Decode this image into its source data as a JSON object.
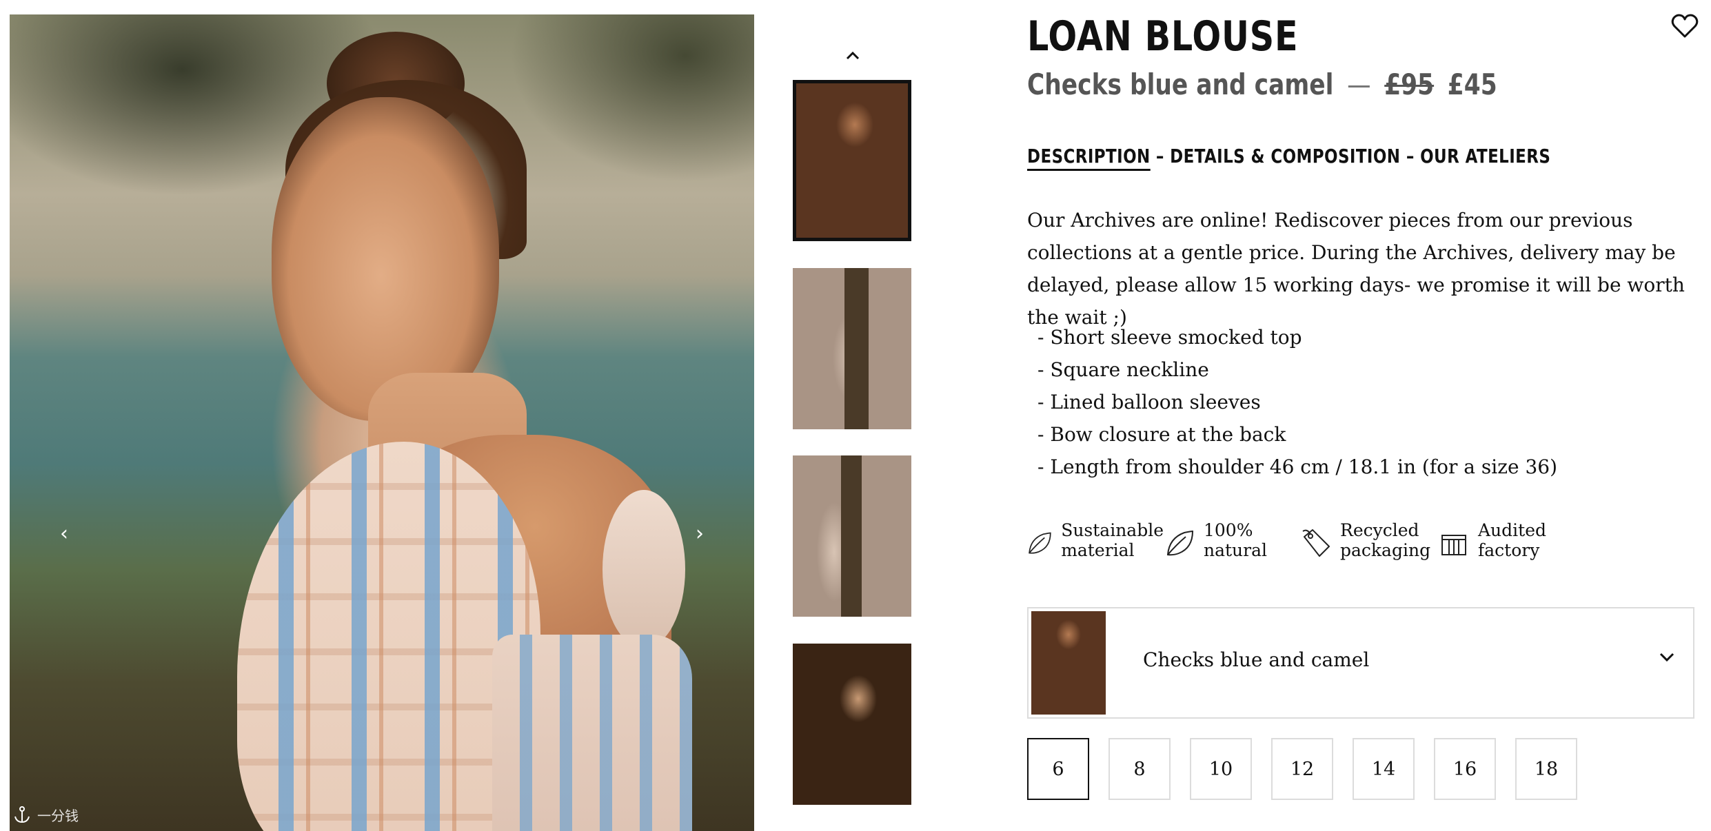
{
  "product": {
    "title": "LOAN BLOUSE",
    "color_name": "Checks blue and camel",
    "separator": "—",
    "old_price": "£95",
    "price": "£45"
  },
  "tabs": {
    "description": "DESCRIPTION",
    "details": " – DETAILS & COMPOSITION – OUR ATELIERS"
  },
  "description": "Our Archives are online! Rediscover pieces from our previous collections at a gentle price. During the Archives, delivery may be delayed, please allow 15 working days- we promise it will be worth the wait ;)",
  "features": [
    "- Short sleeve smocked top",
    "- Square neckline",
    "- Lined balloon sleeves",
    "- Bow closure at the back",
    "- Length from shoulder 46 cm / 18.1 in (for a size 36)"
  ],
  "badges": [
    {
      "line1": "Sustainable",
      "line2": "material",
      "icon": "leaf-icon"
    },
    {
      "line1": "100%",
      "line2": "natural",
      "icon": "leaf-icon"
    },
    {
      "line1": "Recycled",
      "line2": "packaging",
      "icon": "tag-icon"
    },
    {
      "line1": "Audited",
      "line2": "factory",
      "icon": "factory-icon"
    }
  ],
  "color_select": {
    "value": "Checks blue and camel"
  },
  "sizes": [
    "6",
    "8",
    "10",
    "12",
    "14",
    "16",
    "18"
  ],
  "selected_size": "6",
  "watermark": "一分钱",
  "colors": {
    "text": "#111111",
    "muted": "#555555",
    "border": "#dcdcdc"
  }
}
